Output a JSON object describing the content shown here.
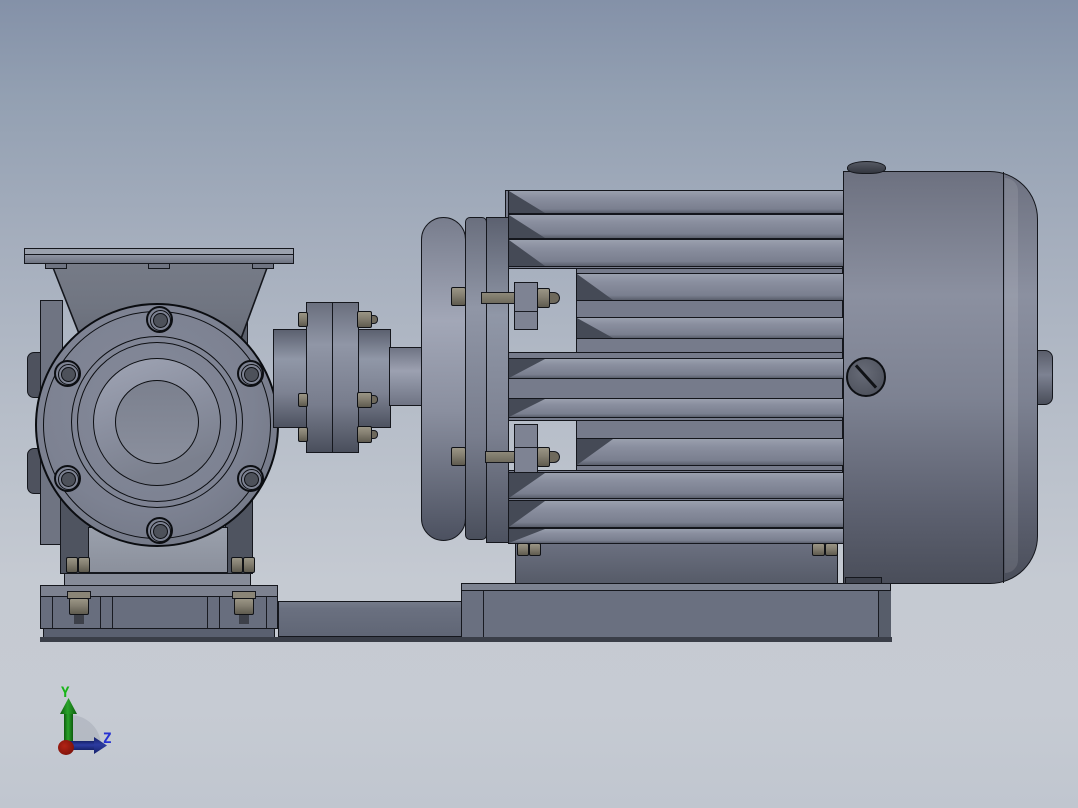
{
  "viewport": {
    "application": "3d-cad-viewport",
    "triad": {
      "y_label": "Y",
      "z_label": "Z",
      "y_axis_color": "#18b518",
      "z_axis_color": "#2732d2",
      "x_axis_color": "#991407"
    },
    "colors": {
      "background_top": "#8491a8",
      "background_bottom": "#c0c6cf",
      "model_gray": "#7d8292",
      "model_dark": "#4d5260",
      "outline": "#15171d",
      "bolt_brass_gray": "#837e70"
    }
  }
}
